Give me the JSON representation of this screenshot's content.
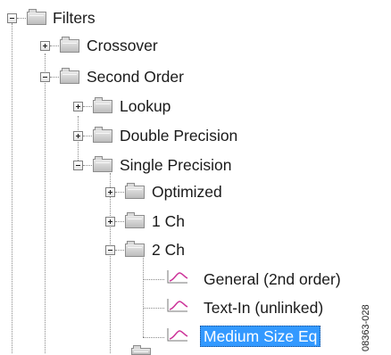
{
  "tree": {
    "root": {
      "label": "Filters",
      "expanded": true
    },
    "items": [
      {
        "label": "Crossover",
        "expanded": false
      },
      {
        "label": "Second Order",
        "expanded": true
      },
      {
        "label": "Lookup",
        "expanded": false
      },
      {
        "label": "Double Precision",
        "expanded": false
      },
      {
        "label": "Single Precision",
        "expanded": true
      },
      {
        "label": "Optimized",
        "expanded": false
      },
      {
        "label": "1 Ch",
        "expanded": false
      },
      {
        "label": "2 Ch",
        "expanded": true
      },
      {
        "label": "General (2nd order)",
        "icon": "filter-response-icon"
      },
      {
        "label": "Text-In (unlinked)",
        "icon": "filter-response-icon"
      },
      {
        "label": "Medium Size Eq",
        "icon": "filter-response-icon",
        "selected": true
      }
    ]
  },
  "figure_code": "08363-028",
  "colors": {
    "selection": "#3399ff",
    "selection_text": "#ffffff",
    "tree_lines": "#8a8a8a",
    "leaf_icon": "#cc3399"
  }
}
